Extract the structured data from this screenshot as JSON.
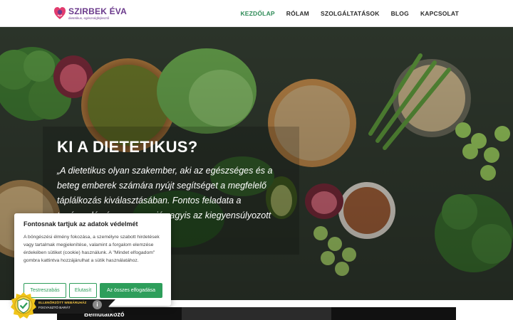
{
  "logo": {
    "name": "SZIRBEK ÉVA",
    "tagline": "dietetikus, egészségfejlesztő"
  },
  "nav": [
    {
      "label": "KEZDŐLAP",
      "active": true
    },
    {
      "label": "RÓLAM",
      "active": false
    },
    {
      "label": "SZOLGÁLTATÁSOK",
      "active": false
    },
    {
      "label": "BLOG",
      "active": false
    },
    {
      "label": "KAPCSOLAT",
      "active": false
    }
  ],
  "hero": {
    "title": "KI A DIETETIKUS?",
    "text": "„A dietetikus olyan szakember, aki az egészséges és a beteg emberek számára nyújt segítséget a megfelelő táplálkozás kiválasztásában. Fontos feladata a tanácsadás és a prevenció vagyis az kiegyensúlyozott ese.”"
  },
  "cookie": {
    "title": "Fontosnak tartjuk az adatok védelmét",
    "text": "A böngészési élmény fokozása, a személyre szabott hirdetések vagy tartalmak megjelenítése, valamint a forgalom elemzése érdekében sütiket (cookie) használunk. A \"Mindet elfogadom\" gombra kattintva hozzájárulhat a sütik használatához.",
    "btn_customize": "Testreszabás",
    "btn_reject": "Elutasít",
    "btn_accept": "Az összes elfogadása"
  },
  "badge": {
    "line1": "ELLENŐRZÖTT WEBÁRUHÁZ",
    "line2": "FOGYASZTÓ BARÁT"
  },
  "video": {
    "label": "Bemutatkozó"
  },
  "colors": {
    "accent": "#2e8b57",
    "brand": "#6b3a8c",
    "button": "#2e9e5b"
  }
}
